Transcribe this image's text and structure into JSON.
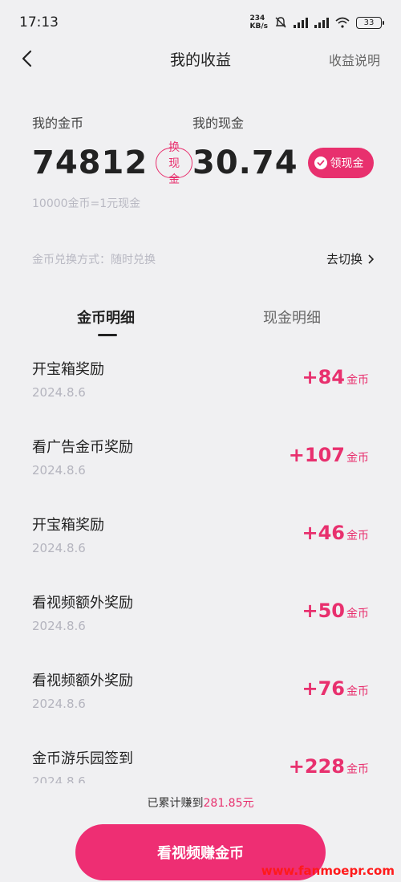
{
  "status_bar": {
    "time": "17:13",
    "net_speed_value": "234",
    "net_speed_unit": "KB/s",
    "battery": "33"
  },
  "header": {
    "title": "我的收益",
    "help_label": "收益说明"
  },
  "balance": {
    "coin_label": "我的金币",
    "coin_value": "74812",
    "exchange_label": "换现金",
    "cash_label": "我的现金",
    "cash_value": "30.74",
    "claim_label": "领现金",
    "rate_text": "10000金币=1元现金"
  },
  "exchange_method": {
    "text": "金币兑换方式：随时兑换",
    "switch_label": "去切换"
  },
  "tabs": [
    {
      "label": "金币明细",
      "active": true
    },
    {
      "label": "现金明细",
      "active": false
    }
  ],
  "records": [
    {
      "title": "开宝箱奖励",
      "date": "2024.8.6",
      "amount": "+84",
      "unit": "金币"
    },
    {
      "title": "看广告金币奖励",
      "date": "2024.8.6",
      "amount": "+107",
      "unit": "金币"
    },
    {
      "title": "开宝箱奖励",
      "date": "2024.8.6",
      "amount": "+46",
      "unit": "金币"
    },
    {
      "title": "看视频额外奖励",
      "date": "2024.8.6",
      "amount": "+50",
      "unit": "金币"
    },
    {
      "title": "看视频额外奖励",
      "date": "2024.8.6",
      "amount": "+76",
      "unit": "金币"
    },
    {
      "title": "金币游乐园签到",
      "date": "2024.8.6",
      "amount": "+228",
      "unit": "金币"
    }
  ],
  "footer": {
    "total_prefix": "已累计赚到",
    "total_value": "281.85元",
    "cta_label": "看视频赚金币"
  },
  "watermark": "www.fanmoepr.com",
  "colors": {
    "accent": "#e8306e",
    "background": "#f0f0f2"
  }
}
